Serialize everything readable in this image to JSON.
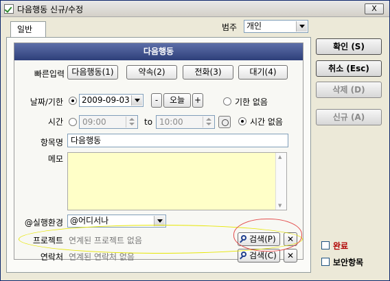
{
  "window": {
    "title": "다음행동 신규/수정",
    "close_label": "X"
  },
  "tab": {
    "label": "일반"
  },
  "category": {
    "label": "범주",
    "value": "개인"
  },
  "section_title": "다음행동",
  "quick_input": {
    "label": "빠른입력",
    "buttons": [
      "다음행동(1)",
      "약속(2)",
      "전화(3)",
      "대기(4)"
    ]
  },
  "date": {
    "label": "날짜/기한",
    "value": "2009-09-03",
    "minus": "-",
    "today": "오늘",
    "plus": "+",
    "no_deadline": "기한 없음"
  },
  "time": {
    "label": "시간",
    "start": "09:00",
    "to": "to",
    "end": "10:00",
    "no_time": "시간 없음"
  },
  "item_name": {
    "label": "항목명",
    "value": "다음행동"
  },
  "memo": {
    "label": "메모",
    "value": ""
  },
  "context": {
    "label": "@실행환경",
    "value": "@어디서나"
  },
  "project": {
    "label": "프로젝트",
    "value": "연계된 프로젝트 없음",
    "search": "검색(P)",
    "clear": "✕"
  },
  "contact": {
    "label": "연락처",
    "value": "연계된 연락처 없음",
    "search": "검색(C)",
    "clear": "✕"
  },
  "side": {
    "ok": "확인 (S)",
    "cancel": "취소 (Esc)",
    "delete": "삭제 (D)",
    "new": "신규 (A)",
    "done": "완료",
    "secure": "보안항목"
  },
  "colors": {
    "header_blue": "#2e3f7a",
    "memo_yellow": "#ffffc8",
    "done_red": "#b00000",
    "annotation_yellow": "#e6e600",
    "annotation_red": "#e34a4a"
  },
  "icons": {
    "title": "checklist-icon",
    "search": "magnifier-icon",
    "clock": "clock-icon"
  }
}
